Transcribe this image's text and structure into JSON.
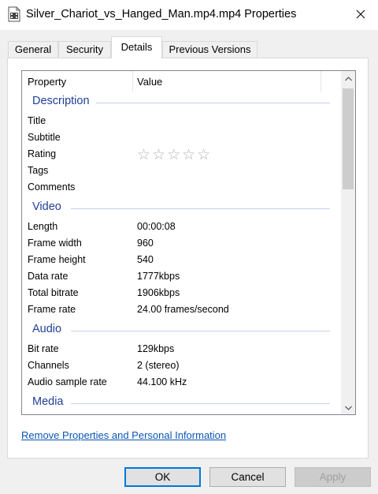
{
  "window": {
    "title": "Silver_Chariot_vs_Hanged_Man.mp4.mp4 Properties",
    "file_icon": "mp4-file-icon",
    "close_icon": "close-icon"
  },
  "tabs": [
    {
      "label": "General"
    },
    {
      "label": "Security"
    },
    {
      "label": "Details",
      "active": true
    },
    {
      "label": "Previous Versions"
    }
  ],
  "list": {
    "columns": {
      "property": "Property",
      "value": "Value"
    },
    "groups": {
      "description": {
        "title": "Description",
        "rows": [
          {
            "key": "Title",
            "value": ""
          },
          {
            "key": "Subtitle",
            "value": ""
          },
          {
            "key": "Rating",
            "value": "★★★★★",
            "rating": 0,
            "rating_max": 5
          },
          {
            "key": "Tags",
            "value": ""
          },
          {
            "key": "Comments",
            "value": ""
          }
        ]
      },
      "video": {
        "title": "Video",
        "rows": [
          {
            "key": "Length",
            "value": "00:00:08"
          },
          {
            "key": "Frame width",
            "value": "960"
          },
          {
            "key": "Frame height",
            "value": "540"
          },
          {
            "key": "Data rate",
            "value": "1777kbps"
          },
          {
            "key": "Total bitrate",
            "value": "1906kbps"
          },
          {
            "key": "Frame rate",
            "value": "24.00 frames/second"
          }
        ]
      },
      "audio": {
        "title": "Audio",
        "rows": [
          {
            "key": "Bit rate",
            "value": "129kbps"
          },
          {
            "key": "Channels",
            "value": "2 (stereo)"
          },
          {
            "key": "Audio sample rate",
            "value": "44.100 kHz"
          }
        ]
      },
      "media": {
        "title": "Media"
      }
    }
  },
  "remove_link": "Remove Properties and Personal Information",
  "buttons": {
    "ok": "OK",
    "cancel": "Cancel",
    "apply": "Apply"
  },
  "colors": {
    "group_title": "#1e3f96",
    "link": "#0b56b3",
    "default_border": "#0078d7"
  }
}
